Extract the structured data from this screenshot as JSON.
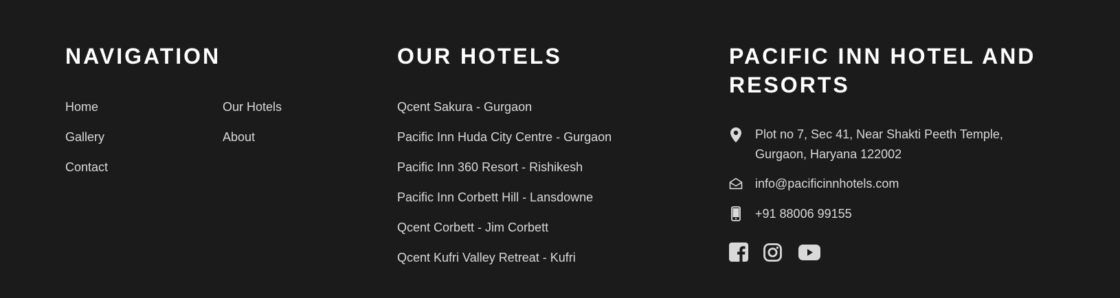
{
  "navigation": {
    "title": "NAVIGATION",
    "links": [
      "Home",
      "Our Hotels",
      "Gallery",
      "About",
      "Contact"
    ]
  },
  "hotels": {
    "title": "OUR HOTELS",
    "links": [
      "Qcent Sakura - Gurgaon",
      "Pacific Inn Huda City Centre - Gurgaon",
      "Pacific Inn 360 Resort - Rishikesh",
      "Pacific Inn Corbett Hill - Lansdowne",
      "Qcent Corbett - Jim Corbett",
      "Qcent Kufri Valley Retreat - Kufri"
    ]
  },
  "contact": {
    "title": "PACIFIC INN HOTEL AND RESORTS",
    "address": "Plot no 7, Sec 41, Near Shakti Peeth Temple, Gurgaon, Haryana 122002",
    "email": "info@pacificinnhotels.com",
    "phone": "+91 88006 99155",
    "social": [
      "facebook-icon",
      "instagram-icon",
      "youtube-icon"
    ]
  },
  "colors": {
    "background": "#1b1b1b",
    "heading": "#ffffff",
    "text": "#d9d9d9"
  }
}
